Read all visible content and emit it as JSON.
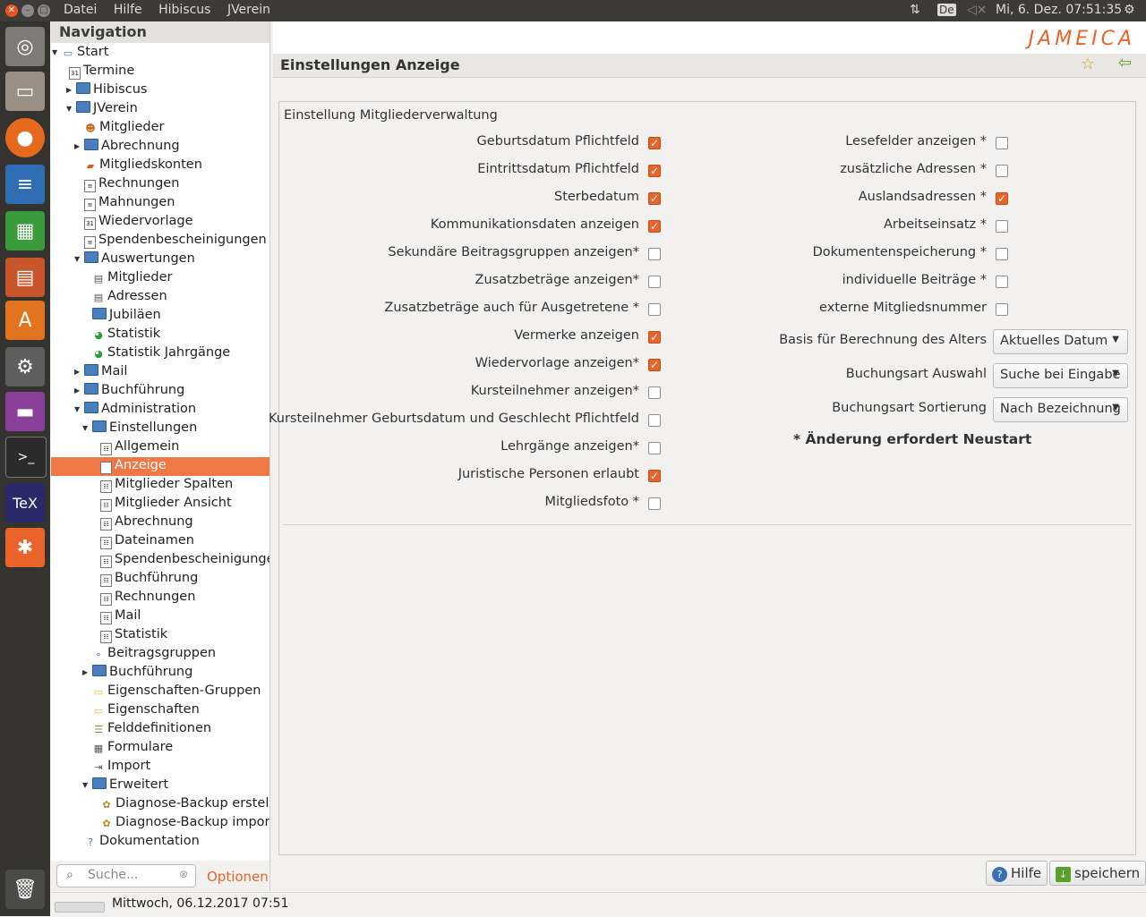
{
  "topbar": {
    "menu": [
      "Datei",
      "Hilfe",
      "Hibiscus",
      "JVerein"
    ],
    "keyboard": "De",
    "clock": "Mi, 6. Dez. 07:51:35"
  },
  "launcher": {
    "items": [
      "dash-icon",
      "files-icon",
      "firefox-icon",
      "writer-icon",
      "calc-icon",
      "impress-icon",
      "software-center-icon",
      "settings-icon",
      "app-icon",
      "terminal-icon",
      "tex-icon",
      "jameica-icon",
      "trash-icon"
    ]
  },
  "nav": {
    "title": "Navigation",
    "items": [
      {
        "label": "Start",
        "icon": "computer-icon"
      },
      {
        "label": "Termine",
        "icon": "calendar-icon"
      },
      {
        "label": "Hibiscus",
        "icon": "folder-icon"
      },
      {
        "label": "JVerein",
        "icon": "folder-icon"
      },
      {
        "label": "Mitglieder",
        "icon": "members-icon"
      },
      {
        "label": "Abrechnung",
        "icon": "folder-icon"
      },
      {
        "label": "Mitgliedskonten",
        "icon": "accounts-icon"
      },
      {
        "label": "Rechnungen",
        "icon": "document-icon"
      },
      {
        "label": "Mahnungen",
        "icon": "document-icon"
      },
      {
        "label": "Wiedervorlage",
        "icon": "calendar-icon"
      },
      {
        "label": "Spendenbescheinigungen",
        "icon": "document-icon"
      },
      {
        "label": "Auswertungen",
        "icon": "folder-icon"
      },
      {
        "label": "Mitglieder",
        "icon": "report-icon"
      },
      {
        "label": "Adressen",
        "icon": "report-icon"
      },
      {
        "label": "Jubiläen",
        "icon": "folder-icon"
      },
      {
        "label": "Statistik",
        "icon": "pie-chart-icon"
      },
      {
        "label": "Statistik Jahrgänge",
        "icon": "pie-chart-icon"
      },
      {
        "label": "Mail",
        "icon": "folder-icon"
      },
      {
        "label": "Buchführung",
        "icon": "folder-icon"
      },
      {
        "label": "Administration",
        "icon": "folder-icon"
      },
      {
        "label": "Einstellungen",
        "icon": "folder-icon"
      },
      {
        "label": "Allgemein",
        "icon": "settings-list-icon"
      },
      {
        "label": "Anzeige",
        "icon": "settings-list-icon"
      },
      {
        "label": "Mitglieder Spalten",
        "icon": "settings-list-icon"
      },
      {
        "label": "Mitglieder Ansicht",
        "icon": "settings-list-icon"
      },
      {
        "label": "Abrechnung",
        "icon": "settings-list-icon"
      },
      {
        "label": "Dateinamen",
        "icon": "settings-list-icon"
      },
      {
        "label": "Spendenbescheinigungen",
        "icon": "settings-list-icon"
      },
      {
        "label": "Buchführung",
        "icon": "settings-list-icon"
      },
      {
        "label": "Rechnungen",
        "icon": "settings-list-icon"
      },
      {
        "label": "Mail",
        "icon": "settings-list-icon"
      },
      {
        "label": "Statistik",
        "icon": "settings-list-icon"
      },
      {
        "label": "Beitragsgruppen",
        "icon": "groups-icon"
      },
      {
        "label": "Buchführung",
        "icon": "folder-icon"
      },
      {
        "label": "Eigenschaften-Gruppen",
        "icon": "property-folder-icon"
      },
      {
        "label": "Eigenschaften",
        "icon": "property-folder-icon"
      },
      {
        "label": "Felddefinitionen",
        "icon": "fields-icon"
      },
      {
        "label": "Formulare",
        "icon": "form-icon"
      },
      {
        "label": "Import",
        "icon": "import-icon"
      },
      {
        "label": "Erweitert",
        "icon": "folder-icon"
      },
      {
        "label": "Diagnose-Backup erstellen",
        "icon": "backup-icon"
      },
      {
        "label": "Diagnose-Backup importieren",
        "icon": "backup-icon"
      },
      {
        "label": "Dokumentation",
        "icon": "help-icon"
      }
    ]
  },
  "search": {
    "placeholder": "Suche...",
    "options_label": "Optionen"
  },
  "status": {
    "text": "Mittwoch, 06.12.2017 07:51"
  },
  "main": {
    "logo": "JAMEICA",
    "title": "Einstellungen Anzeige",
    "group_title": "Einstellung Mitgliederverwaltung",
    "left_checks": [
      {
        "label": "Geburtsdatum Pflichtfeld",
        "checked": true
      },
      {
        "label": "Eintrittsdatum Pflichtfeld",
        "checked": true
      },
      {
        "label": "Sterbedatum",
        "checked": true
      },
      {
        "label": "Kommunikationsdaten anzeigen",
        "checked": true
      },
      {
        "label": "Sekundäre Beitragsgruppen anzeigen*",
        "checked": false
      },
      {
        "label": "Zusatzbeträge anzeigen*",
        "checked": false
      },
      {
        "label": "Zusatzbeträge auch für Ausgetretene *",
        "checked": false
      },
      {
        "label": "Vermerke anzeigen",
        "checked": true
      },
      {
        "label": "Wiedervorlage anzeigen*",
        "checked": true
      },
      {
        "label": "Kursteilnehmer anzeigen*",
        "checked": false
      },
      {
        "label": "Kursteilnehmer Geburtsdatum und Geschlecht Pflichtfeld",
        "checked": false
      },
      {
        "label": "Lehrgänge anzeigen*",
        "checked": false
      },
      {
        "label": "Juristische Personen erlaubt",
        "checked": true
      },
      {
        "label": "Mitgliedsfoto *",
        "checked": false
      }
    ],
    "right_checks": [
      {
        "label": "Lesefelder anzeigen *",
        "checked": false
      },
      {
        "label": "zusätzliche Adressen *",
        "checked": false
      },
      {
        "label": "Auslandsadressen *",
        "checked": true
      },
      {
        "label": "Arbeitseinsatz *",
        "checked": false
      },
      {
        "label": "Dokumentenspeicherung *",
        "checked": false
      },
      {
        "label": "individuelle Beiträge *",
        "checked": false
      },
      {
        "label": "externe Mitgliedsnummer",
        "checked": false
      }
    ],
    "selects": [
      {
        "label": "Basis für Berechnung des Alters",
        "value": "Aktuelles Datum"
      },
      {
        "label": "Buchungsart Auswahl",
        "value": "Suche bei Eingabe"
      },
      {
        "label": "Buchungsart Sortierung",
        "value": "Nach Bezeichnung"
      }
    ],
    "note": "* Änderung erfordert Neustart",
    "help_button": "Hilfe",
    "save_button": "speichern"
  }
}
